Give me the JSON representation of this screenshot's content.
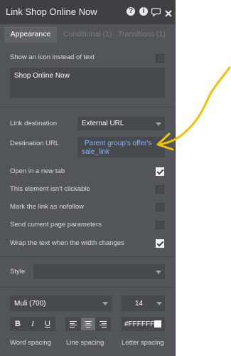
{
  "window": {
    "title": "Link Shop Online Now"
  },
  "title_icons": [
    "help-icon",
    "info-icon",
    "comment-icon",
    "close-icon"
  ],
  "tabs": [
    {
      "label": "Appearance",
      "active": true
    },
    {
      "label": "Conditional (1)",
      "active": false
    },
    {
      "label": "Transitions (1)",
      "active": false
    }
  ],
  "icon_toggle": {
    "label": "Show an icon instead of text",
    "checked": false
  },
  "text_value": "Shop Online Now",
  "link_destination": {
    "label": "Link destination",
    "value": "External URL"
  },
  "destination_url": {
    "label": "Destination URL",
    "line1": "Parent group's offer's",
    "line2": "sale_link"
  },
  "options": [
    {
      "label": "Open in a new tab",
      "checked": true
    },
    {
      "label": "This element isn't clickable",
      "checked": false
    },
    {
      "label": "Mark the link as nofollow",
      "checked": false
    },
    {
      "label": "Send current page parameters",
      "checked": false
    },
    {
      "label": "Wrap the text when the width changes",
      "checked": true
    }
  ],
  "style": {
    "label": "Style",
    "value": ""
  },
  "font": {
    "family": "Muli (700)",
    "size": "14"
  },
  "format_buttons": {
    "bold": "B",
    "italic": "I",
    "underline": "U"
  },
  "color": {
    "value": "#FFFFFF",
    "swatch": "#ffffff"
  },
  "spacing_labels": {
    "word": "Word spacing",
    "line": "Line spacing",
    "letter": "Letter spacing"
  },
  "colors": {
    "panel": "#52555a",
    "titlebar": "#3e4044",
    "field": "#46494d",
    "link": "#8ab4f8",
    "arrow": "#f2c200"
  }
}
